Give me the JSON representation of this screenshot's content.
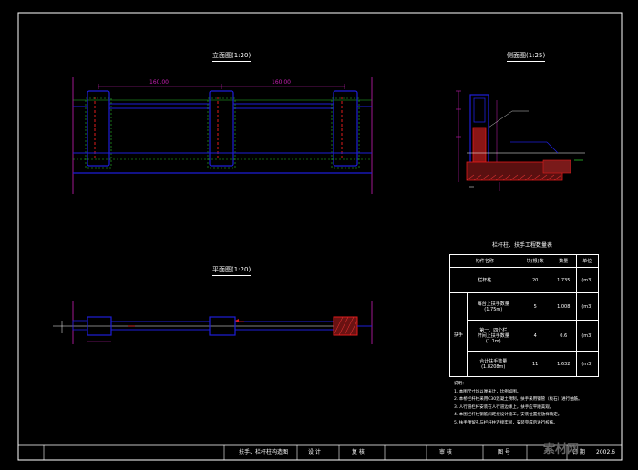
{
  "views": {
    "elevation_title": "立面图(1:20)",
    "side_title": "侧面图(1:25)",
    "plan_title": "平面图(1:20)"
  },
  "elevation_dims": {
    "left_span": "160.00",
    "right_span": "160.00"
  },
  "table": {
    "title": "栏杆柱、扶手工程数量表",
    "headers": [
      "构件名称",
      "块(根)数",
      "数量",
      "单位"
    ],
    "rows": [
      {
        "name": "栏杆柱",
        "count": "20",
        "qty": "1.735",
        "unit": "(m3)"
      },
      {
        "name": "每台上扶手数量\n(1.75m)",
        "count": "5",
        "qty": "1.008",
        "unit": "(m3)"
      },
      {
        "name": "第一、四个栏\n杆间上扶手数量\n(1.1m)",
        "count": "4",
        "qty": "0.6",
        "unit": "(m3)"
      },
      {
        "name": "合计扶手数量\n(1.8208m)",
        "count": "11",
        "qty": "1.632",
        "unit": "(m3)"
      }
    ],
    "group_label": "扶手"
  },
  "notes": {
    "heading": "说明：",
    "items": [
      "1. 本图尺寸均以厘米计，比例如图。",
      "2. 本桥栏杆柱采用C30混凝土预制，扶手采用钢管（板石）进行抽筋。",
      "3. 人行道栏杆安装在人行道边缘上，扶手应平顺美观。",
      "4. 本图栏杆柱钢筋间距按设计施工，安装位置按放样确定。",
      "5. 扶手预留孔与栏杆柱连接牢固，安装完成后进行校核。"
    ]
  },
  "title_block": {
    "drawing_name": "扶手、栏杆柱构造图",
    "design": "设 计",
    "review": "复 核",
    "approve": "审 核",
    "sheet_label": "图 号",
    "date_label": "日 期",
    "date_value": "2002.6"
  },
  "watermark": "素材网",
  "colors": {
    "outline": "#ffffff",
    "structure": "#1e1ed8",
    "rebar": "#e01b1b",
    "hidden": "#2bc02b",
    "dimension": "#c81fb4",
    "hatch": "#b01a1a"
  }
}
